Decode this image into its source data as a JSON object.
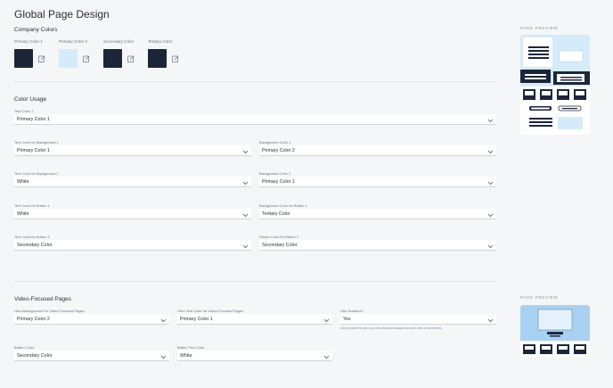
{
  "page": {
    "title": "Global Page Design"
  },
  "company_colors": {
    "heading": "Company Colors",
    "swatches": [
      {
        "label": "Primary Color 1",
        "color": "#1c2638"
      },
      {
        "label": "Primary Color 2",
        "color": "#d6ebfa"
      },
      {
        "label": "Secondary Color",
        "color": "#1c2638"
      },
      {
        "label": "Tertiary Color",
        "color": "#1c2638"
      }
    ]
  },
  "color_usage": {
    "heading": "Color Usage",
    "text_color_1": {
      "label": "Text Color 1",
      "value": "Primary Color 1"
    },
    "text_bg1": {
      "label": "Text Color for Background 1",
      "value": "Primary Color 1"
    },
    "bg1": {
      "label": "Background Color 1",
      "value": "Primary Color 2"
    },
    "text_bg2": {
      "label": "Text Color for Background 2",
      "value": "White"
    },
    "bg2": {
      "label": "Background Color 2",
      "value": "Primary Color 1"
    },
    "text_btn1": {
      "label": "Text Color for Button 1",
      "value": "White"
    },
    "bg_btn1": {
      "label": "Background Color for Button 1",
      "value": "Tertiary Color"
    },
    "text_btn2": {
      "label": "Text Color for Button 2",
      "value": "Secondary Color"
    },
    "stroke_btn2": {
      "label": "Stroke Color for Button 2",
      "value": "Secondary Color"
    }
  },
  "video_pages": {
    "heading": "Video-Focused Pages",
    "hero_bg": {
      "label": "Hero Background For Video-Focused Pages",
      "value": "Primary Color 2"
    },
    "hero_text": {
      "label": "Hero Text Color for Video-Focused Pages",
      "value": "Primary Color 1"
    },
    "gradient": {
      "label": "Use Gradient?",
      "value": "Yes",
      "helper": "Add a gradient to give your video-focused background some extra visual interest."
    },
    "button_color": {
      "label": "Button Color",
      "value": "Secondary Color"
    },
    "button_text": {
      "label": "Button Text Color",
      "value": "White"
    }
  },
  "preview": {
    "label": "PAGE PREVIEW",
    "label_2": "PAGE PREVIEW"
  },
  "colors": {
    "dark": "#1c2638",
    "light": "#d6ebfa",
    "white": "#ffffff"
  }
}
